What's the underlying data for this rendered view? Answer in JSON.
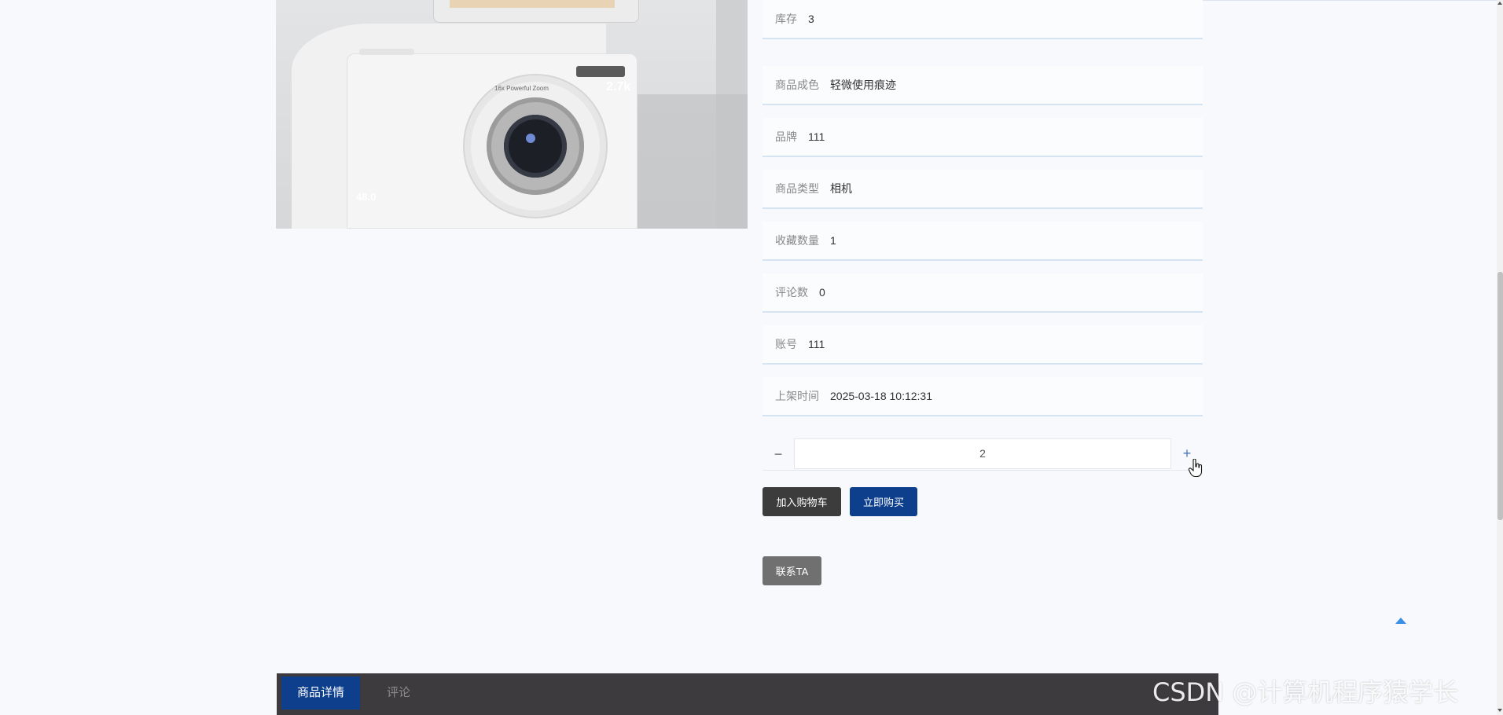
{
  "product": {
    "image_labels": {
      "lens_text": "16x Powerful Zoom",
      "resolution_top": "2.7k",
      "resolution_bottom": "48.0"
    },
    "fields": [
      {
        "label": "库存",
        "value": "3"
      },
      {
        "label": "商品成色",
        "value": "轻微使用痕迹"
      },
      {
        "label": "品牌",
        "value": "111"
      },
      {
        "label": "商品类型",
        "value": "相机"
      },
      {
        "label": "收藏数量",
        "value": "1"
      },
      {
        "label": "评论数",
        "value": "0"
      },
      {
        "label": "账号",
        "value": "111"
      },
      {
        "label": "上架时间",
        "value": "2025-03-18 10:12:31"
      }
    ]
  },
  "quantity": {
    "minus": "−",
    "value": "2",
    "plus": "+"
  },
  "actions": {
    "add_to_cart": "加入购物车",
    "buy_now": "立即购买",
    "contact": "联系TA"
  },
  "tabs": [
    {
      "label": "商品详情",
      "active": true
    },
    {
      "label": "评论",
      "active": false
    }
  ],
  "watermark": "CSDN @计算机程序猿学长",
  "colors": {
    "primary": "#0d3f8c",
    "cart_button": "#3c3c3c",
    "contact_button": "#707070",
    "tab_bar": "#3d3b3e",
    "row_border": "#d6e4f2",
    "back_to_top": "#3a8ee6"
  },
  "icons": {
    "back_to_top": "caret-up-icon",
    "cursor": "hand-pointer-icon"
  }
}
